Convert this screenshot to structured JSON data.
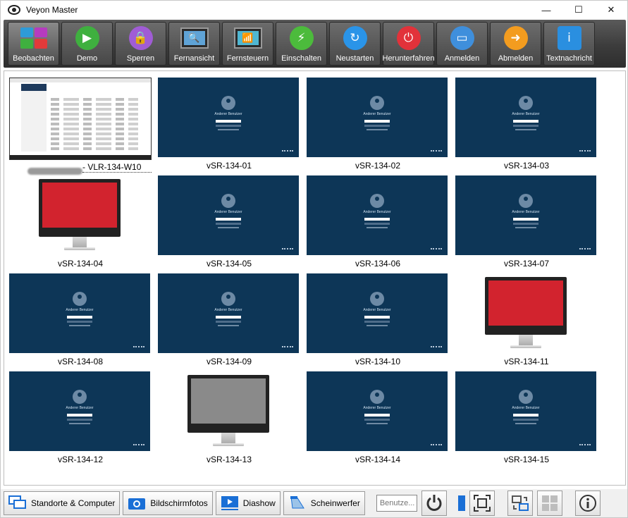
{
  "window": {
    "title": "Veyon Master",
    "minimize_glyph": "—",
    "maximize_glyph": "☐",
    "close_glyph": "✕"
  },
  "toolbar": {
    "buttons": [
      {
        "label": "Beobachten",
        "icon": "tiles-icon"
      },
      {
        "label": "Demo",
        "icon": "presentation-icon"
      },
      {
        "label": "Sperren",
        "icon": "lock-icon"
      },
      {
        "label": "Fernansicht",
        "icon": "monitor-zoom-icon"
      },
      {
        "label": "Fernsteuern",
        "icon": "monitor-wifi-icon"
      },
      {
        "label": "Einschalten",
        "icon": "power-on-icon"
      },
      {
        "label": "Neustarten",
        "icon": "restart-icon"
      },
      {
        "label": "Herunterfahren",
        "icon": "shutdown-icon"
      },
      {
        "label": "Anmelden",
        "icon": "login-card-icon"
      },
      {
        "label": "Abmelden",
        "icon": "logout-arrow-icon"
      },
      {
        "label": "Textnachricht",
        "icon": "message-icon"
      }
    ],
    "colors": [
      "#1e90ff",
      "#3fb03f",
      "#a05cd5",
      "#5fa3d6",
      "#4fb7d2",
      "#4cbb3c",
      "#2a94e8",
      "#e2323a",
      "#3f8fdc",
      "#f39c1f",
      "#2a8fe0"
    ],
    "icon_glyphs": [
      "",
      "▶",
      "🔒",
      "🔍",
      "📶",
      "⚡",
      "↻",
      "⏻",
      "▭",
      "➜",
      "i"
    ]
  },
  "computers": [
    {
      "name": "VLR-134-W10",
      "state": "desktop"
    },
    {
      "name": "vSR-134-01",
      "state": "login"
    },
    {
      "name": "vSR-134-02",
      "state": "login"
    },
    {
      "name": "vSR-134-03",
      "state": "login"
    },
    {
      "name": "vSR-134-04",
      "state": "offline-red"
    },
    {
      "name": "vSR-134-05",
      "state": "login"
    },
    {
      "name": "vSR-134-06",
      "state": "login"
    },
    {
      "name": "vSR-134-07",
      "state": "login"
    },
    {
      "name": "vSR-134-08",
      "state": "login"
    },
    {
      "name": "vSR-134-09",
      "state": "login"
    },
    {
      "name": "vSR-134-10",
      "state": "login"
    },
    {
      "name": "vSR-134-11",
      "state": "offline-red"
    },
    {
      "name": "vSR-134-12",
      "state": "login"
    },
    {
      "name": "vSR-134-13",
      "state": "offline-grey"
    },
    {
      "name": "vSR-134-14",
      "state": "login"
    },
    {
      "name": "vSR-134-15",
      "state": "login"
    }
  ],
  "login_screen": {
    "user_label": "Anderer Benutzer"
  },
  "first_tile_prefix": "- ",
  "bottombar": {
    "locations_label": "Standorte & Computer",
    "screenshots_label": "Bildschirmfotos",
    "slideshow_label": "Diashow",
    "spotlight_label": "Scheinwerfer",
    "search_placeholder": "Benutze..."
  },
  "colors": {
    "accent": "#1a6fd6",
    "login_bg": "#0d3657",
    "offline_red": "#d2232e",
    "offline_grey": "#8a8a8a"
  }
}
